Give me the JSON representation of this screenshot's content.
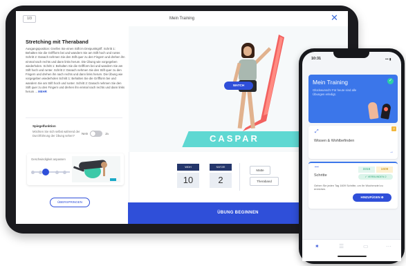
{
  "tablet": {
    "counter": "1/3",
    "window_title": "Mein Training",
    "close_icon": "close-icon",
    "exercise": {
      "title": "Stretching mit Theraband",
      "description": "Ausgangsposition: Greifen Sie einen Stift im Dreipunktgriff. Schritt 1: Behalten Sie die Griffform bei und wandern Sie am Stift hoch und runter. Schritt 2: Danach nehmen Sie den Stift quer zu den Fingern und drehen ihn einmal nach rechts und dann links herum. Die Übung wie vorgegeben wiederholen. Schritt 1: Behalten Sie die Griffform bei und wandern Sie am Stift hoch und runter. Schritt 2: Danach nehmen Sie den Stift quer zu den Fingern und drehen ihn nach rechts und dann links herum. Die Übung wie vorgegeben wiederholen Schritt 1: Behalten Sie die Griffform bei und wandern Sie am Stift hoch und runter. Schritt 2: Danach nehmen Sie den Stift quer zu den Fingern und drehen ihn einmal nach rechts und dann links herum ...",
      "more_label": "MEHR"
    },
    "mirror": {
      "title": "Spiegelfunktion",
      "description": "Möchten Sie sich selbst während der Durchführung der Übung sehen?",
      "no_label": "Nein",
      "yes_label": "Ja",
      "enabled": false
    },
    "speed": {
      "title": "Geschwindigkeit anpassen",
      "level": 3,
      "levels": 5
    },
    "skip_label": "ÜBERSPRINGEN",
    "video": {
      "watch_label": "WATCH",
      "mat_text": "CASPAR"
    },
    "params": [
      {
        "label": "WDH",
        "value": "10"
      },
      {
        "label": "SÄTZE",
        "value": "2"
      }
    ],
    "equipment": [
      "Matte",
      "Theraband"
    ],
    "start_label": "ÜBUNG BEGINNEN"
  },
  "phone": {
    "time": "10:31",
    "status": "••• ▮",
    "training": {
      "title": "Mein Training",
      "subtitle": "Glückwunsch! Für heute sind alle Übungen erledigt."
    },
    "wellbeing": {
      "title": "Wissen & Wohlbefinden",
      "badge": "7"
    },
    "steps": {
      "title": "Schritte",
      "value1": "3315",
      "value2": "1609",
      "connected_label": "VERBUNDEN",
      "connected_count": "2",
      "description": "Gehen Sie jeden Tag 1609 Schritte, um Ihr Wochenziel zu erreichen.",
      "add_label": "HINZUFÜGEN"
    }
  },
  "colors": {
    "accent": "#2f4fd9",
    "card_blue": "#3b76ea",
    "mat_teal": "#5fd8d2",
    "band_red": "#f2615f",
    "success": "#2bd0a5"
  }
}
